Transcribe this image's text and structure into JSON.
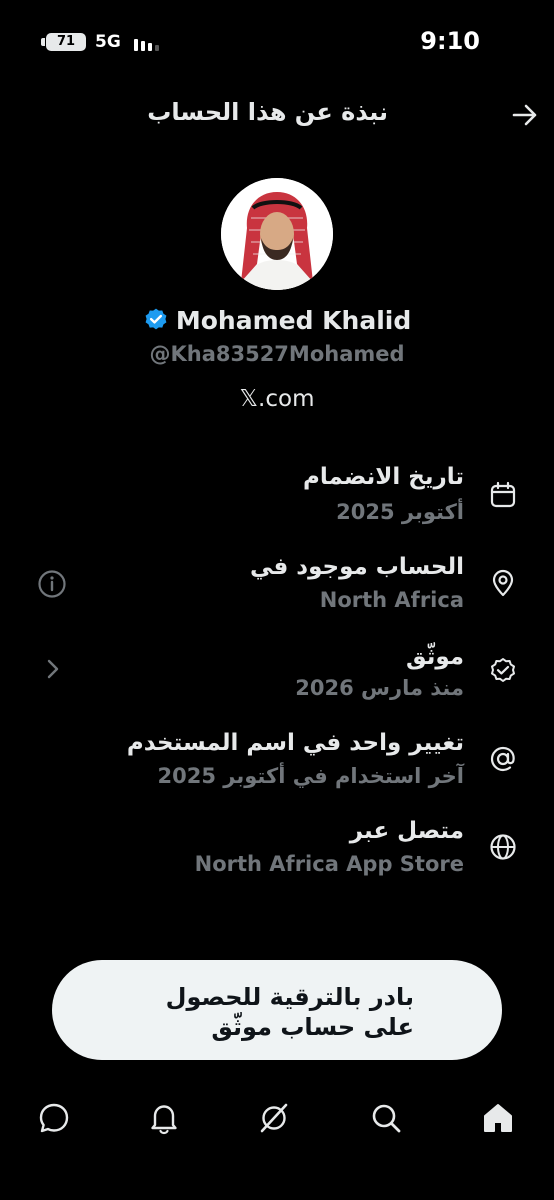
{
  "status_bar": {
    "battery": "71",
    "network": "5G",
    "time": "9:10"
  },
  "header": {
    "title": "نبذة عن هذا الحساب",
    "back_icon": "arrow-right-icon"
  },
  "profile": {
    "display_name": "Mohamed Khalid",
    "handle": "@Kha83527Mohamed",
    "site": "𝕏.com",
    "verified": true,
    "colors": {
      "verified_badge": "#1d9bf0"
    }
  },
  "info_rows": [
    {
      "icon": "calendar-icon",
      "title": "تاريخ الانضمام",
      "subtitle": "أكتوبر 2025"
    },
    {
      "icon": "location-pin-icon",
      "title": "الحساب موجود في",
      "subtitle": "North Africa",
      "left_icon": "info-circle-icon"
    },
    {
      "icon": "verified-check-icon",
      "title": "موثّق",
      "subtitle": "منذ مارس 2026",
      "left_icon": "chevron-right-icon"
    },
    {
      "icon": "at-sign-icon",
      "title": "تغيير واحد في اسم المستخدم",
      "subtitle": "آخر استخدام في أكتوبر 2025"
    },
    {
      "icon": "globe-icon",
      "title": "متصل عبر",
      "subtitle": "North Africa App Store"
    }
  ],
  "upgrade_button": {
    "label": "بادر بالترقية للحصول على حساب موثّق"
  },
  "bottom_nav": {
    "items": [
      "messages-icon",
      "notifications-icon",
      "grok-icon",
      "search-icon",
      "home-icon"
    ],
    "active": "home-icon"
  }
}
